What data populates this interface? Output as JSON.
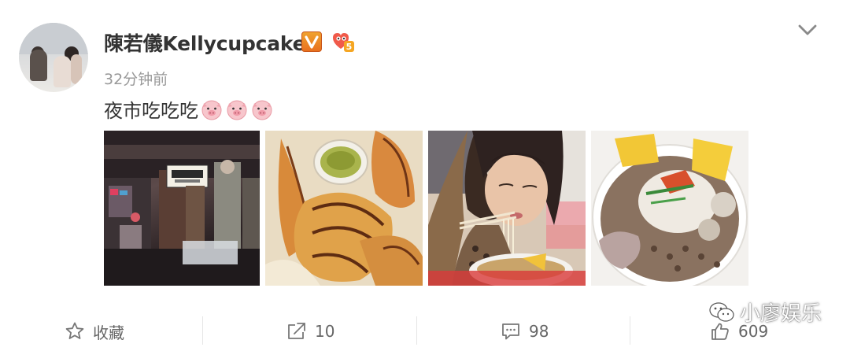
{
  "post": {
    "username": "陳若儀Kellycupcake",
    "time": "32分钟前",
    "text": "夜市吃吃吃"
  },
  "icons": {
    "verified": "verified-v-icon",
    "level": "member-level-icon",
    "more": "chevron-down-icon",
    "emoji": "pig-emoji-icon"
  },
  "actions": {
    "favorite_label": "收藏",
    "repost_count": "10",
    "comment_count": "98",
    "like_count": "609"
  },
  "watermark": {
    "text": "小廖娱乐"
  },
  "colors": {
    "verified_badge": "#e8701f",
    "text_primary": "#333333",
    "text_secondary": "#999999",
    "action_text": "#666666"
  }
}
